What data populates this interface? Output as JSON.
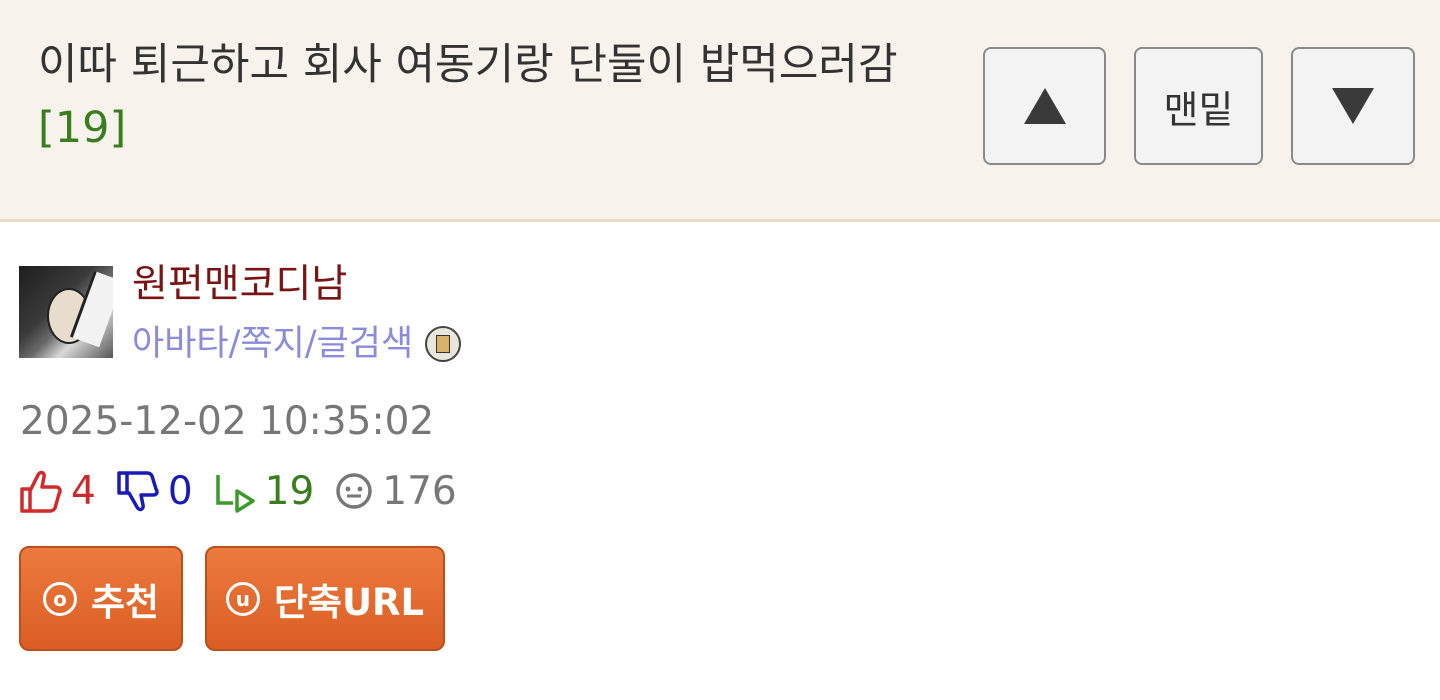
{
  "header": {
    "title": "이따 퇴근하고 회사 여동기랑 단둘이 밥먹으러감",
    "comment_count": "[19]",
    "nav": {
      "up_icon": "triangle-up-icon",
      "bottom_label": "맨밑",
      "down_icon": "triangle-down-icon"
    }
  },
  "author": {
    "name": "원펀맨코디남",
    "links": [
      "아바타",
      "쪽지",
      "글검색"
    ],
    "link_separator": "/",
    "icon": "mail-badge-icon"
  },
  "post": {
    "datetime": "2025-12-02 10:35:02",
    "stats": {
      "upvotes": "4",
      "downvotes": "0",
      "replies": "19",
      "views": "176"
    }
  },
  "actions": {
    "recommend": {
      "circle": "o",
      "label": "추천"
    },
    "short_url": {
      "circle": "u",
      "label": "단축URL"
    }
  },
  "colors": {
    "header_bg": "#f8f2ec",
    "count_green": "#3a7d1f",
    "author_red": "#7a1313",
    "link_purple": "#8a8bdc",
    "up_red": "#cc2a2a",
    "down_blue": "#1a1ab8",
    "button_orange": "#e36a2f"
  }
}
